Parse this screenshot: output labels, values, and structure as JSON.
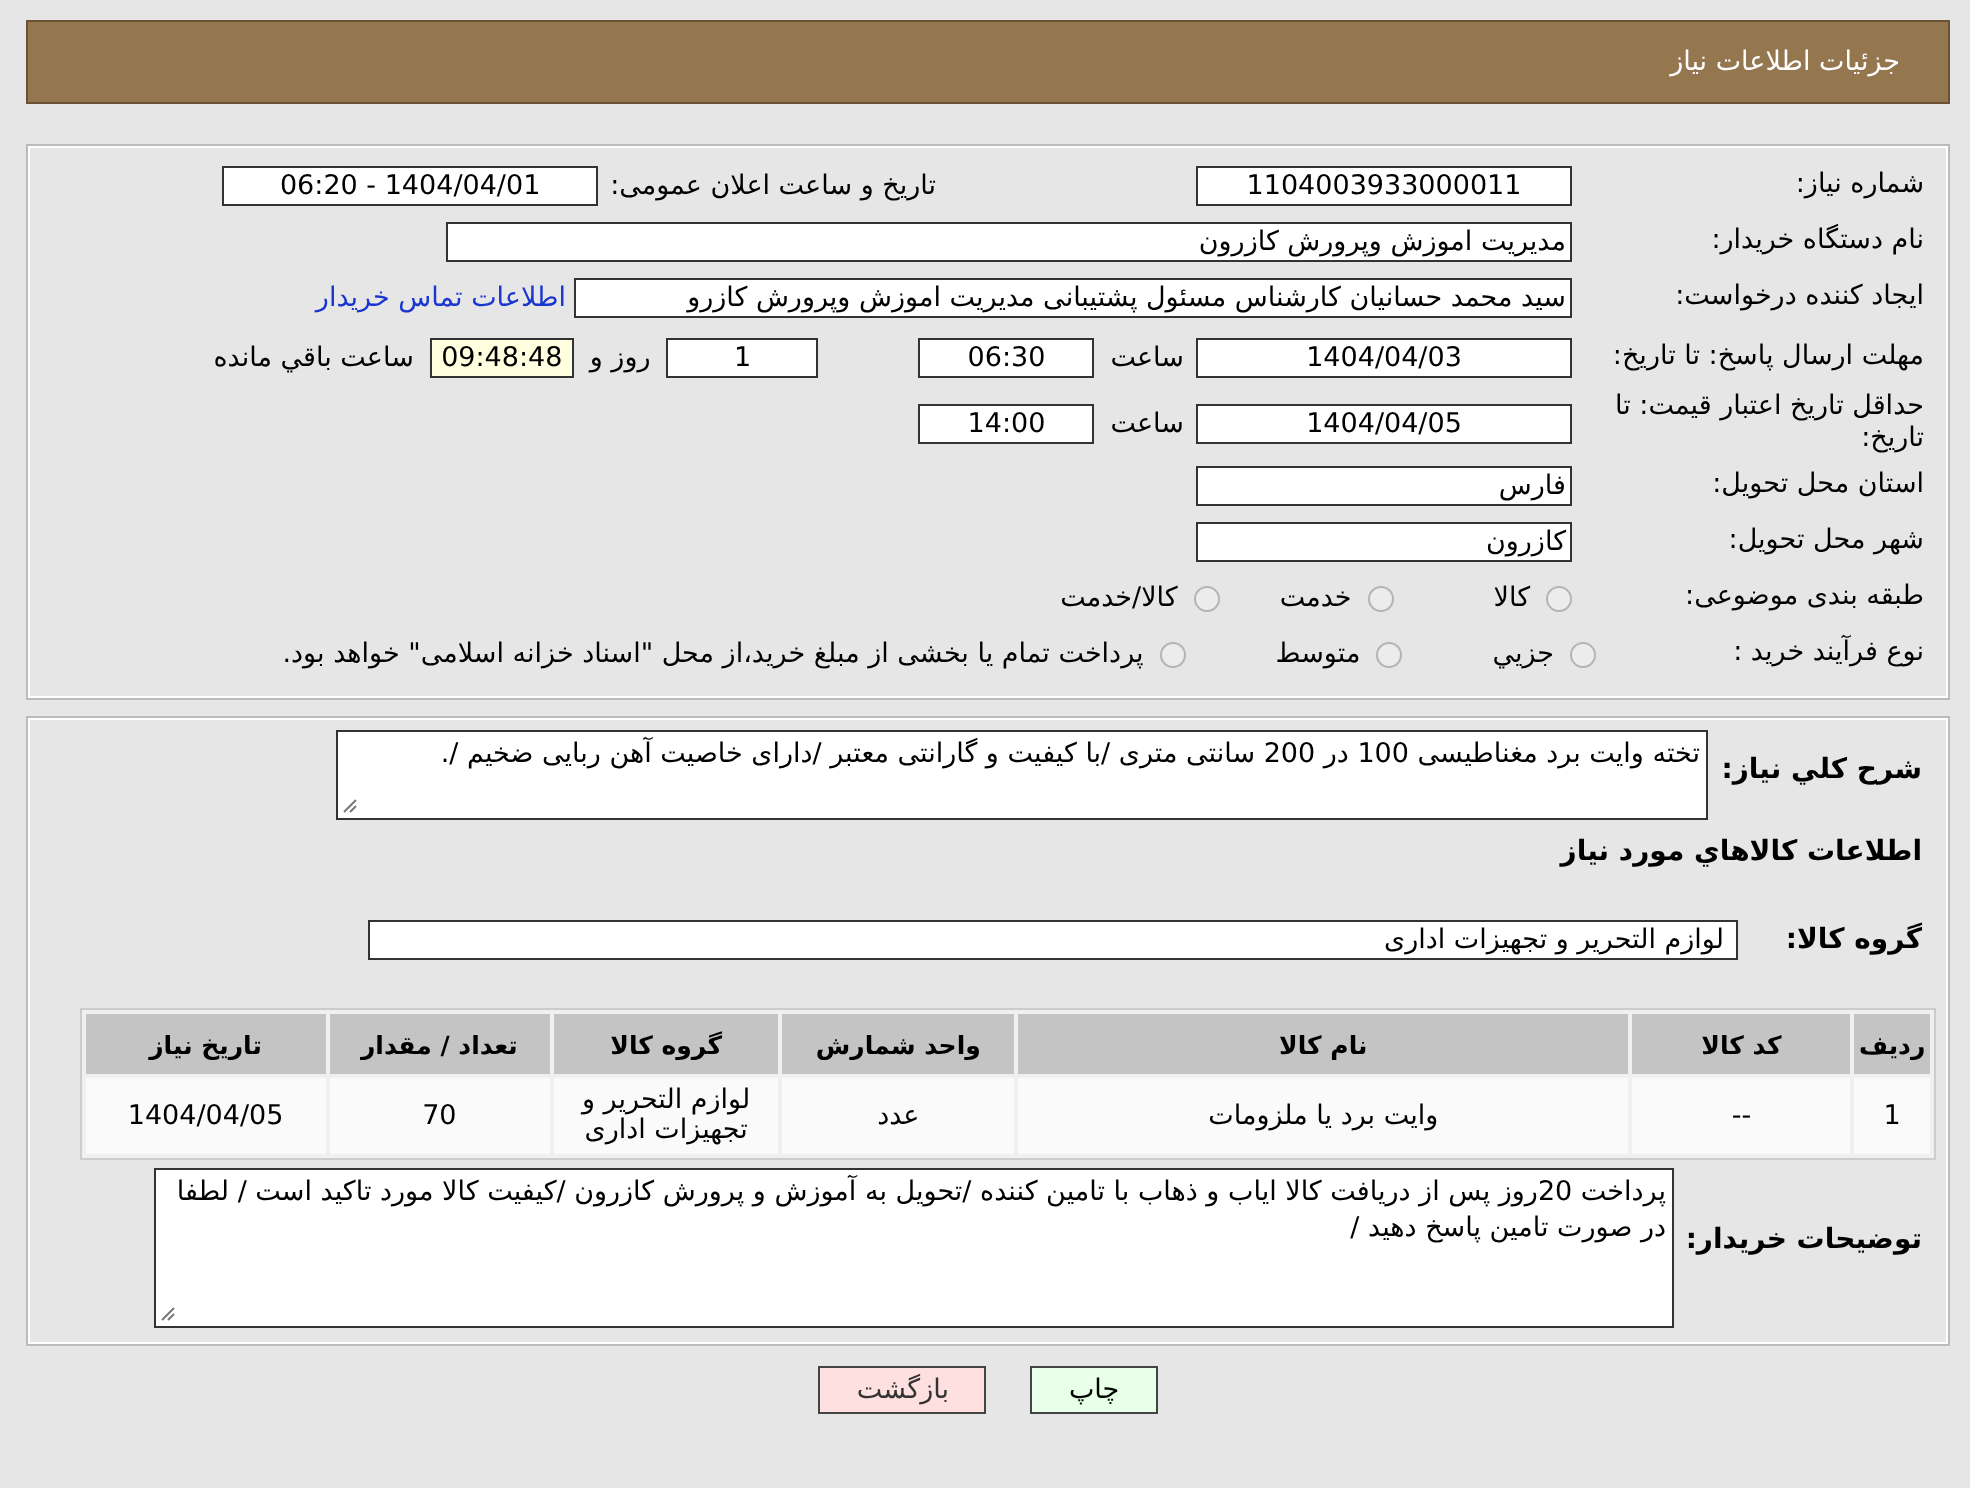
{
  "header": {
    "title": "جزئیات اطلاعات نیاز"
  },
  "need_number": {
    "label": "شماره نیاز:",
    "value": "1104003933000011"
  },
  "announce": {
    "label": "تاریخ و ساعت اعلان عمومی:",
    "value": "1404/04/01 - 06:20"
  },
  "buyer": {
    "label": "نام دستگاه خریدار:",
    "value": "مدیریت اموزش وپرورش کازرون"
  },
  "creator": {
    "label": "ایجاد کننده درخواست:",
    "value": "سید محمد  حسانیان  کارشناس مسئول پشتیبانی مدیریت اموزش وپرورش کازرو",
    "link": "اطلاعات تماس خریدار"
  },
  "reply_deadline": {
    "label": "مهلت ارسال پاسخ: تا تاریخ:",
    "date": "1404/04/03",
    "time_label": "ساعت",
    "time": "06:30",
    "days": "1",
    "days_label": "روز و",
    "remaining": "09:48:48",
    "remaining_label": "ساعت باقي مانده"
  },
  "price_validity": {
    "label": "حداقل تاریخ اعتبار قیمت: تا تاریخ:",
    "date": "1404/04/05",
    "time_label": "ساعت",
    "time": "14:00"
  },
  "province": {
    "label": "استان محل تحویل:",
    "value": "فارس"
  },
  "city": {
    "label": "شهر محل تحویل:",
    "value": "کازرون"
  },
  "category": {
    "label": "طبقه بندی موضوعی:",
    "options": [
      {
        "label": "کالا",
        "selected": false
      },
      {
        "label": "خدمت",
        "selected": false
      },
      {
        "label": "کالا/خدمت",
        "selected": false
      }
    ]
  },
  "process": {
    "label": "نوع فرآیند خرید :",
    "options": [
      {
        "label": "جزيي",
        "selected": false
      },
      {
        "label": "متوسط",
        "selected": false
      },
      {
        "label": "پرداخت تمام یا بخشی از مبلغ خرید،از محل \"اسناد خزانه اسلامی\" خواهد بود.",
        "selected": false
      }
    ]
  },
  "description": {
    "label": "شرح كلي نیاز:",
    "value": "تخته وایت برد مغناطیسی 100 در 200 سانتی متری /با کیفیت و گارانتی معتبر /دارای خاصیت آهن ربایی ضخیم /."
  },
  "goods_heading": "اطلاعات كالاهاي مورد نياز",
  "goods_group": {
    "label": "گروه کالا:",
    "value": "لوازم التحریر و تجهیزات اداری"
  },
  "table": {
    "columns": [
      "ردیف",
      "کد کالا",
      "نام کالا",
      "واحد شمارش",
      "گروه کالا",
      "تعداد / مقدار",
      "تاریخ نیاز"
    ],
    "rows": [
      [
        "1",
        "--",
        "وایت برد یا ملزومات",
        "عدد",
        "لوازم التحریر و تجهیزات اداری",
        "70",
        "1404/04/05"
      ]
    ]
  },
  "notes": {
    "label": "توضیحات خریدار:",
    "value": "پرداخت 20روز پس از دریافت کالا ایاب و ذهاب با تامین کننده /تحویل به آموزش و پرورش کازرون /کیفیت کالا مورد تاکید است / لطفا در صورت تامین پاسخ دهید /"
  },
  "buttons": [
    {
      "label": "چاپ",
      "kind": "print"
    },
    {
      "label": "بازگشت",
      "kind": "back"
    }
  ]
}
